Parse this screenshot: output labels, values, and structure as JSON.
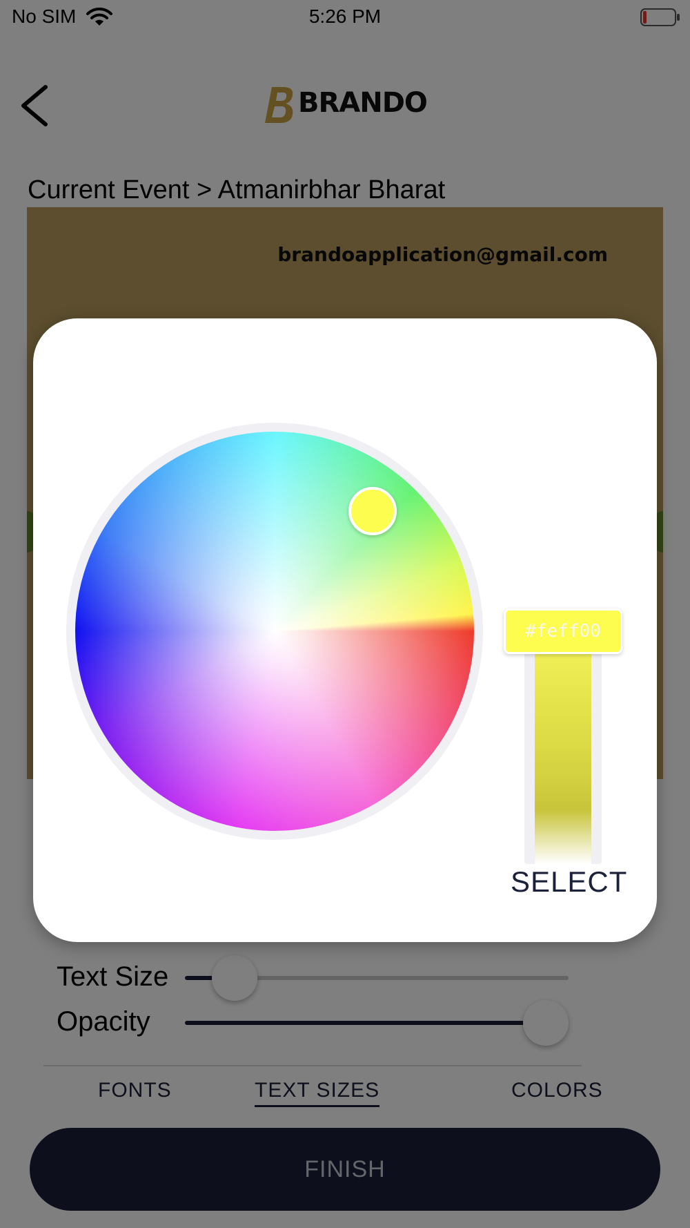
{
  "status_bar": {
    "carrier": "No SIM",
    "time": "5:26 PM",
    "wifi_icon": "wifi-icon",
    "battery_icon": "battery-icon",
    "battery_color": "#e53935"
  },
  "header": {
    "back_icon": "chevron-left-icon",
    "logo_text": "BRANDO",
    "logo_accent": "#b8912e"
  },
  "breadcrumb": "Current Event > Atmanirbhar Bharat",
  "event_card": {
    "email": "brandoapplication@gmail.com",
    "background": "#b89d5c"
  },
  "controls": {
    "text_size": {
      "label": "Text Size",
      "value": 0.13
    },
    "opacity": {
      "label": "Opacity",
      "value": 0.94
    }
  },
  "tabs": [
    {
      "label": "FONTS",
      "active": false
    },
    {
      "label": "TEXT SIZES",
      "active": true
    },
    {
      "label": "COLORS",
      "active": false
    }
  ],
  "finish_label": "FINISH",
  "color_picker": {
    "hex": "#feff00",
    "selected_color": "#fdfd50",
    "select_label": "SELECT"
  }
}
